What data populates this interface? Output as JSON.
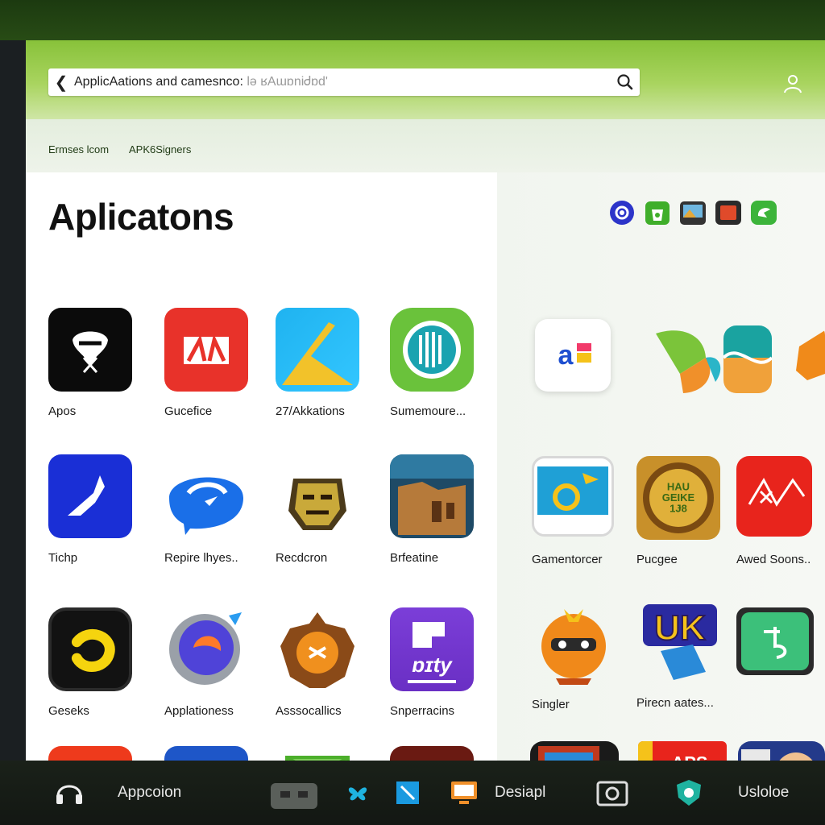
{
  "search": {
    "back_icon": "arrow-left-icon",
    "query": "ApplicAations and camesnco:",
    "query_faded": " lə ʁAɯɒniᏧɒd'",
    "search_icon": "magnifier-icon"
  },
  "header": {
    "user_icon": "user-icon"
  },
  "subnav": {
    "items": [
      "Ermses lcom",
      "APK6Signers"
    ]
  },
  "page": {
    "title": "Aplicatons"
  },
  "apps": [
    {
      "label": "Apos"
    },
    {
      "label": "Gucefice"
    },
    {
      "label": "27/Akkations"
    },
    {
      "label": "Sumemoure..."
    },
    {
      "label": "Tichp"
    },
    {
      "label": "Repire lhyes.."
    },
    {
      "label": "Recdcron"
    },
    {
      "label": "Brfeatine"
    },
    {
      "label": "Geseks"
    },
    {
      "label": "Applationess"
    },
    {
      "label": "Asssocallics"
    },
    {
      "label": "Snperracins"
    },
    {
      "label": ""
    },
    {
      "label": ""
    },
    {
      "label": ""
    },
    {
      "label": ""
    }
  ],
  "featured": [
    {
      "label": ""
    },
    {
      "label": ""
    },
    {
      "label": ""
    },
    {
      "label": ""
    },
    {
      "label": "Gamentorcer"
    },
    {
      "label": "Pucgee"
    },
    {
      "label": "Awed Soons.."
    },
    {
      "label": "Singler"
    },
    {
      "label": "Pirecn aates..."
    },
    {
      "label": ""
    },
    {
      "label": ""
    },
    {
      "label": ""
    },
    {
      "label": ""
    }
  ],
  "icon_text": {
    "featured_a": "a",
    "pucgee_badge": "HAU\nGEIKE\n1Ɉ8",
    "pirecn_badge": "UK",
    "app12_badge": "ɒɪty",
    "apps_store": "APS\nTARE"
  },
  "taskbar": {
    "items": [
      {
        "label": "Appcoion"
      },
      {
        "label": "Desiapl"
      },
      {
        "label": "Usloloe"
      }
    ]
  },
  "colors": {
    "header_green": "#88c23a",
    "accent_green": "#4caf2b",
    "taskbar_bg": "#131713"
  }
}
